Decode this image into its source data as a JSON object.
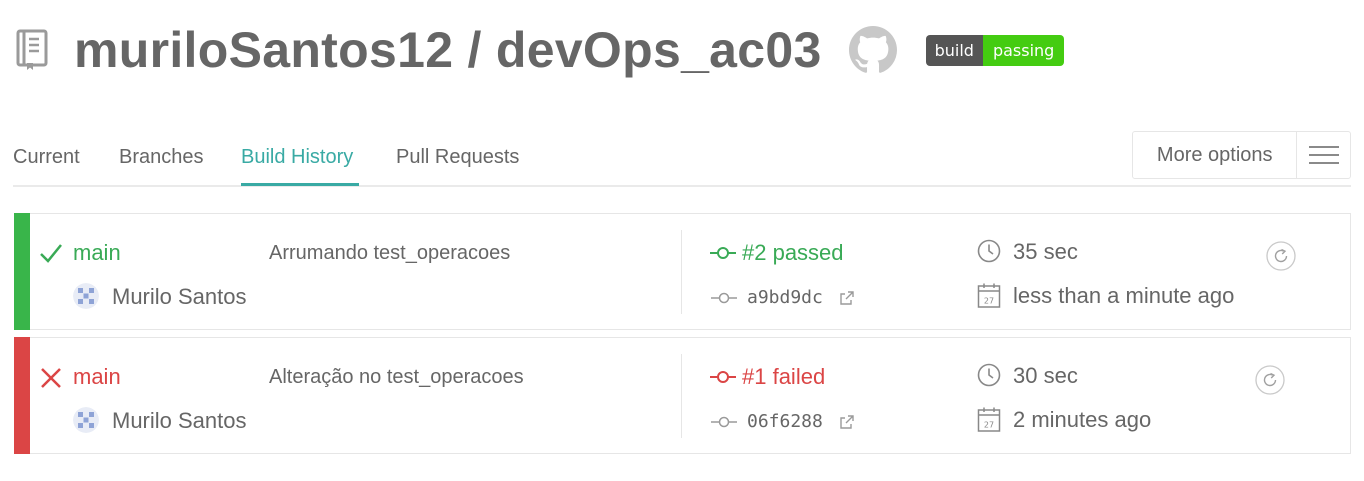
{
  "header": {
    "repo_title": "muriloSantos12 / devOps_ac03",
    "badge": {
      "label": "build",
      "status": "passing",
      "label_color": "#555555",
      "status_color": "#44cc11"
    }
  },
  "tabs": [
    {
      "label": "Current",
      "active": false
    },
    {
      "label": "Branches",
      "active": false
    },
    {
      "label": "Build History",
      "active": true
    },
    {
      "label": "Pull Requests",
      "active": false
    }
  ],
  "more_options": {
    "label": "More options"
  },
  "colors": {
    "accent": "#39aaa4",
    "passed": "#39aa56",
    "failed": "#db4545"
  },
  "builds": [
    {
      "state": "passed",
      "branch": "main",
      "commit_message": "Arrumando test_operacoes",
      "author": "Murilo Santos",
      "build_status": "#2 passed",
      "commit_sha": "a9bd9dc",
      "duration": "35 sec",
      "finished": "less than a minute ago"
    },
    {
      "state": "failed",
      "branch": "main",
      "commit_message": "Alteração no test_operacoes",
      "author": "Murilo Santos",
      "build_status": "#1 failed",
      "commit_sha": "06f6288",
      "duration": "30 sec",
      "finished": "2 minutes ago"
    }
  ]
}
